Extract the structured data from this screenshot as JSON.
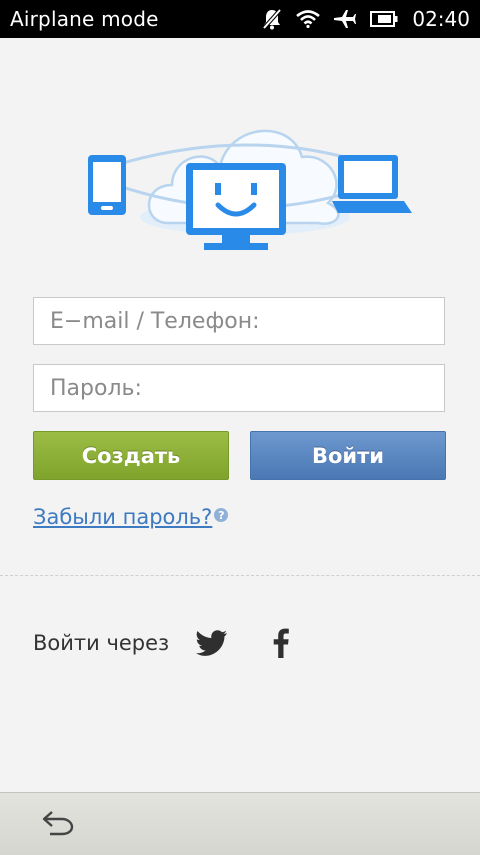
{
  "status_bar": {
    "title": "Airplane mode",
    "time": "02:40",
    "icons": [
      "notifications-muted-icon",
      "wifi-icon",
      "airplane-icon",
      "battery-icon"
    ]
  },
  "hero": {
    "icon": "cloud-sync-devices-illustration"
  },
  "form": {
    "email_placeholder": "E−mail / Телефон:",
    "password_placeholder": "Пароль:"
  },
  "buttons": {
    "create_label": "Создать",
    "login_label": "Войти"
  },
  "forgot": {
    "label": "Забыли пароль?",
    "help_glyph": "?"
  },
  "social": {
    "label": "Войти через",
    "providers": [
      "twitter-icon",
      "facebook-icon"
    ]
  },
  "nav": {
    "back_icon": "back-icon"
  },
  "colors": {
    "accent_blue": "#2a8ae8",
    "create_green": "#8db33a",
    "login_blue": "#5a87c3",
    "link_blue": "#3d7ac1"
  }
}
